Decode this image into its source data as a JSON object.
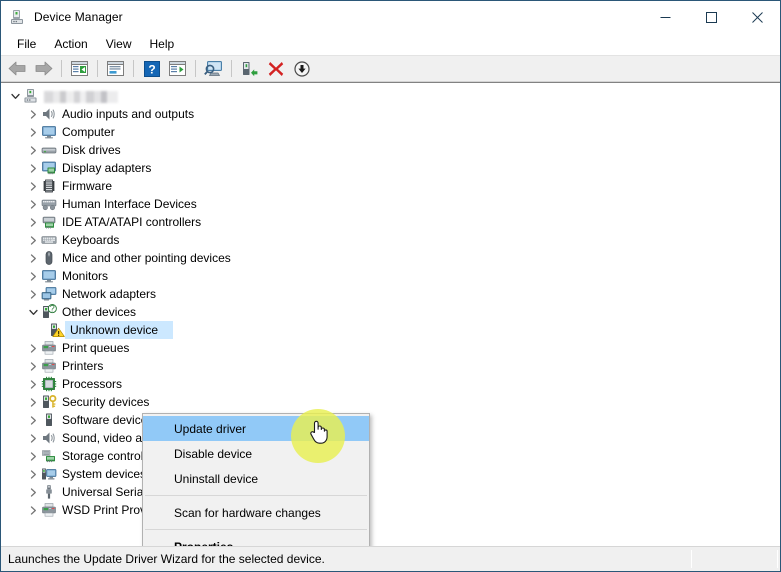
{
  "window": {
    "title": "Device Manager",
    "icon": "device-manager-icon",
    "caption_buttons": [
      {
        "name": "minimize-button",
        "glyph": "minimize"
      },
      {
        "name": "maximize-button",
        "glyph": "maximize"
      },
      {
        "name": "close-button",
        "glyph": "close"
      }
    ]
  },
  "menubar": {
    "items": [
      {
        "label": "File"
      },
      {
        "label": "Action"
      },
      {
        "label": "View"
      },
      {
        "label": "Help"
      }
    ]
  },
  "toolbar": {
    "buttons": [
      {
        "name": "back-button",
        "icon": "back-arrow-icon"
      },
      {
        "name": "forward-button",
        "icon": "forward-arrow-icon"
      },
      {
        "name": "up-one-level-button",
        "icon": "show-hide-console-tree-icon"
      },
      {
        "name": "properties-button",
        "icon": "properties-icon"
      },
      {
        "name": "help-button",
        "icon": "help-question-icon"
      },
      {
        "name": "show-hide-action-pane-button",
        "icon": "action-pane-icon"
      },
      {
        "name": "scan-hardware-changes-button",
        "icon": "scan-monitor-icon"
      },
      {
        "name": "update-driver-button",
        "icon": "update-driver-icon"
      },
      {
        "name": "uninstall-device-button",
        "icon": "red-x-icon"
      },
      {
        "name": "disable-device-button",
        "icon": "disable-down-arrow-icon"
      }
    ]
  },
  "tree": {
    "root": {
      "label": "",
      "label_redacted": true,
      "icon": "computer-icon",
      "expanded": true
    },
    "items": [
      {
        "label": "Audio inputs and outputs",
        "icon": "speaker-icon",
        "expanded": false,
        "depth": 1
      },
      {
        "label": "Computer",
        "icon": "monitor-icon",
        "expanded": false,
        "depth": 1
      },
      {
        "label": "Disk drives",
        "icon": "disk-drive-icon",
        "expanded": false,
        "depth": 1
      },
      {
        "label": "Display adapters",
        "icon": "display-adapter-icon",
        "expanded": false,
        "depth": 1
      },
      {
        "label": "Firmware",
        "icon": "firmware-chip-icon",
        "expanded": false,
        "depth": 1
      },
      {
        "label": "Human Interface Devices",
        "icon": "hid-icon",
        "expanded": false,
        "depth": 1
      },
      {
        "label": "IDE ATA/ATAPI controllers",
        "icon": "ide-controller-icon",
        "expanded": false,
        "depth": 1
      },
      {
        "label": "Keyboards",
        "icon": "keyboard-icon",
        "expanded": false,
        "depth": 1
      },
      {
        "label": "Mice and other pointing devices",
        "icon": "mouse-icon",
        "expanded": false,
        "depth": 1
      },
      {
        "label": "Monitors",
        "icon": "monitor-icon",
        "expanded": false,
        "depth": 1
      },
      {
        "label": "Network adapters",
        "icon": "network-adapter-icon",
        "expanded": false,
        "depth": 1
      },
      {
        "label": "Other devices",
        "icon": "other-device-question-icon",
        "expanded": true,
        "depth": 1
      },
      {
        "label": "Unknown device",
        "icon": "unknown-device-warning-icon",
        "selected": true,
        "depth": 2
      },
      {
        "label": "Print queues",
        "icon": "printer-icon",
        "expanded": false,
        "depth": 1
      },
      {
        "label": "Printers",
        "icon": "printer-icon",
        "expanded": false,
        "depth": 1
      },
      {
        "label": "Processors",
        "icon": "processor-icon",
        "expanded": false,
        "depth": 1
      },
      {
        "label": "Security devices",
        "icon": "security-device-key-icon",
        "expanded": false,
        "depth": 1
      },
      {
        "label": "Software devices",
        "icon": "software-device-icon",
        "expanded": false,
        "depth": 1
      },
      {
        "label": "Sound, video and game controllers",
        "icon": "speaker-icon",
        "expanded": false,
        "depth": 1
      },
      {
        "label": "Storage controllers",
        "icon": "storage-controller-icon",
        "expanded": false,
        "depth": 1
      },
      {
        "label": "System devices",
        "icon": "system-device-icon",
        "expanded": false,
        "depth": 1
      },
      {
        "label": "Universal Serial Bus controllers",
        "icon": "usb-icon",
        "expanded": false,
        "depth": 1
      },
      {
        "label": "WSD Print Provider",
        "icon": "printer-icon",
        "expanded": false,
        "depth": 1
      }
    ]
  },
  "context_menu": {
    "items": [
      {
        "label": "Update driver",
        "highlighted": true,
        "bold": false
      },
      {
        "label": "Disable device",
        "highlighted": false,
        "bold": false
      },
      {
        "label": "Uninstall device",
        "highlighted": false,
        "bold": false
      },
      {
        "separator": true
      },
      {
        "label": "Scan for hardware changes",
        "highlighted": false,
        "bold": false
      },
      {
        "separator": true
      },
      {
        "label": "Properties",
        "highlighted": false,
        "bold": true
      }
    ]
  },
  "statusbar": {
    "text": "Launches the Update Driver Wizard for the selected device."
  },
  "colors": {
    "selection_blue": "#cce8ff",
    "menu_highlight_blue": "#91c9f7",
    "click_halo_yellow": "#e8ef52",
    "window_border": "#2b5778",
    "toolbar_bg": "#f0f0f0",
    "warning_yellow": "#ffd42a",
    "uninstall_red": "#d32222"
  }
}
